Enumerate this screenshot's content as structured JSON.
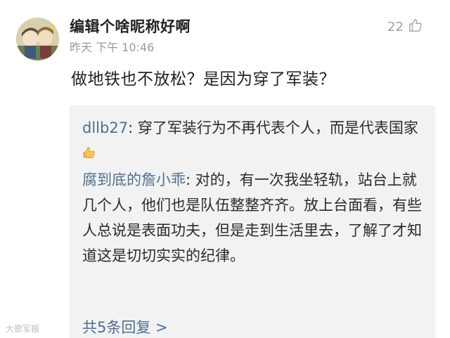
{
  "post": {
    "username": "编辑个啥昵称好啊",
    "timestamp": "昨天 下午 10:46",
    "like_count": "22",
    "text": "做地铁也不放松？是因为穿了军装？"
  },
  "replies": [
    {
      "author": "dllb27",
      "separator": ": ",
      "text": "穿了军装行为不再代表个人，而是代表国家"
    },
    {
      "author": "腐到底的詹小乖",
      "separator": ": ",
      "text": "对的，有一次我坐轻轨，站台上就几个人，他们也是队伍整整齐齐。放上台面看，有些人总说是表面功夫，但是走到生活里去，了解了才知道这是切切实实的纪律。"
    }
  ],
  "more_replies_label": "共5条回复 >",
  "watermark": "大歌军报",
  "icons": {
    "like": "thumbs-up-outline-icon",
    "emoji": "thumbs-up-emoji-icon",
    "avatar": "anime-avatar"
  }
}
